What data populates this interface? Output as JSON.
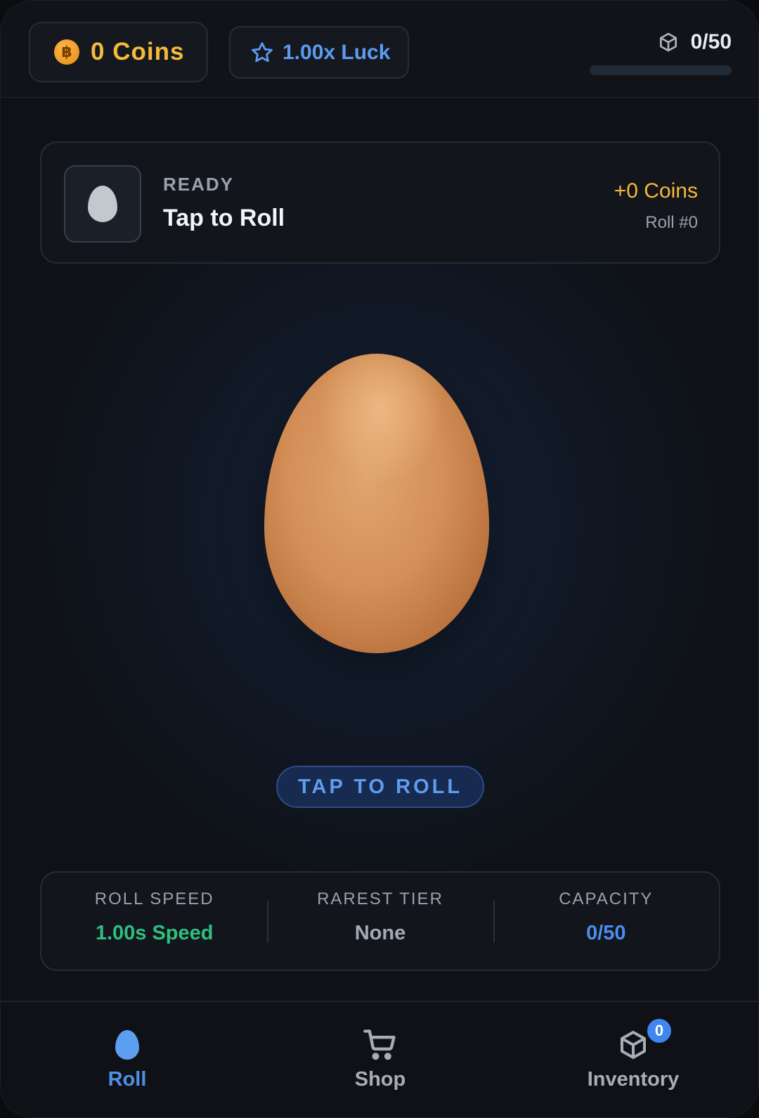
{
  "header": {
    "coins_label": "0 Coins",
    "coin_icon_glyph": "฿",
    "luck_label": "1.00x Luck",
    "capacity_label": "0/50",
    "capacity_fill": 0
  },
  "status": {
    "state": "READY",
    "title": "Tap to Roll",
    "reward": "+0 Coins",
    "roll_count": "Roll #0"
  },
  "roll_button": "TAP TO ROLL",
  "stats": [
    {
      "label": "ROLL SPEED",
      "value": "1.00s Speed"
    },
    {
      "label": "RAREST TIER",
      "value": "None"
    },
    {
      "label": "CAPACITY",
      "value": "0/50"
    }
  ],
  "nav": [
    {
      "label": "Roll",
      "icon": "egg-icon"
    },
    {
      "label": "Shop",
      "icon": "cart-icon"
    },
    {
      "label": "Inventory",
      "icon": "box-icon",
      "badge": "0"
    }
  ],
  "colors": {
    "accent_blue": "#4b8df0",
    "coin_gold": "#f5b93b",
    "speed_green": "#2fbf7e"
  }
}
